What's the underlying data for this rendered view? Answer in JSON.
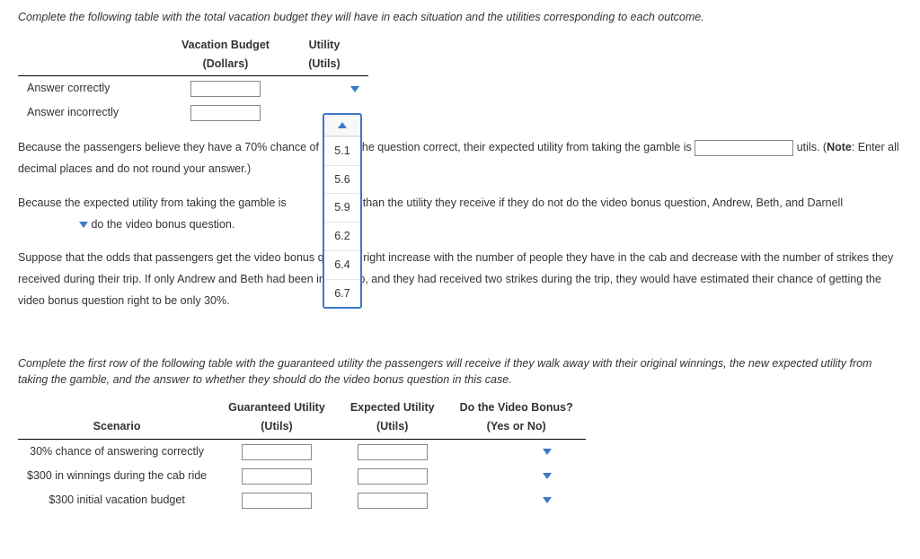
{
  "instruction1": "Complete the following table with the total vacation budget they will have in each situation and the utilities corresponding to each outcome.",
  "table1": {
    "col1": "Vacation Budget",
    "col1_sub": "(Dollars)",
    "col2": "Utility",
    "col2_sub": "(Utils)",
    "row1": "Answer correctly",
    "row2": "Answer incorrectly"
  },
  "dropdown_options": [
    "5.1",
    "5.6",
    "5.9",
    "6.2",
    "6.4",
    "6.7"
  ],
  "p1_a": "Because the passengers believe they have a 70% chance of getting the question correct, their expected utility from taking the gamble is ",
  "p1_b": " utils. (",
  "p1_note_label": "Note",
  "p1_note_rest": ": Enter all decimal places and do not round your answer.)",
  "p2_a": "Because the expected utility from taking the gamble is ",
  "p2_b": " than the utility they receive if they do not do the video bonus question, Andrew, Beth, and Darnell ",
  "p2_c": " do the video bonus question.",
  "p3": "Suppose that the odds that passengers get the video bonus question right increase with the number of people they have in the cab and decrease with the number of strikes they received during their trip. If only Andrew and Beth had been in the cab, and they had received two strikes during the trip, they would have estimated their chance of getting the video bonus question right to be only 30%.",
  "instruction2": "Complete the first row of the following table with the guaranteed utility the passengers will receive if they walk away with their original winnings, the new expected utility from taking the gamble, and the answer to whether they should do the video bonus question in this case.",
  "table2": {
    "col1": "Scenario",
    "col2": "Guaranteed Utility",
    "col2_sub": "(Utils)",
    "col3": "Expected Utility",
    "col3_sub": "(Utils)",
    "col4": "Do the Video Bonus?",
    "col4_sub": "(Yes or No)",
    "rows": [
      "30% chance of answering correctly",
      "$300 in winnings during the cab ride",
      "$300 initial vacation budget"
    ]
  }
}
